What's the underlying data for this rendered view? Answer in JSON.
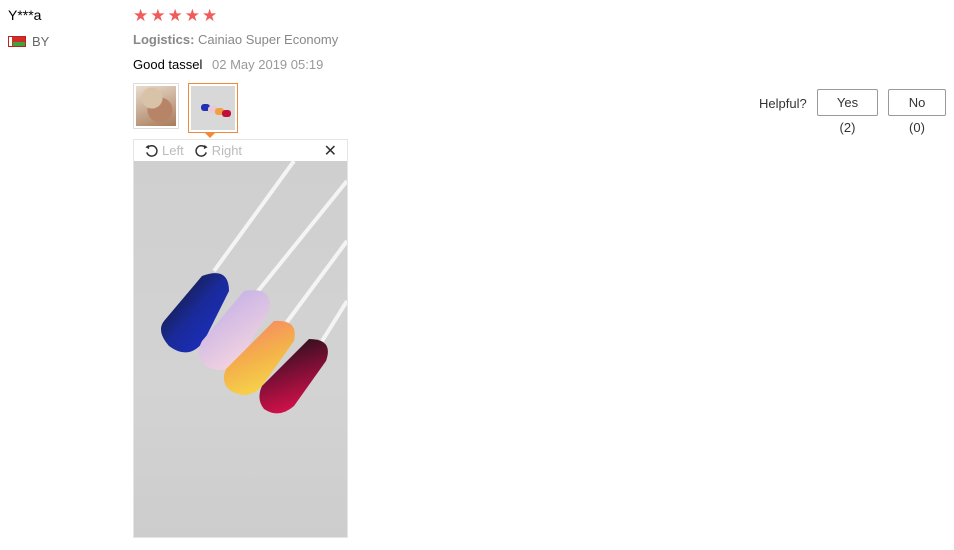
{
  "user": {
    "name": "Y***a",
    "country": "BY"
  },
  "rating": {
    "stars": 5
  },
  "logistics": {
    "label": "Logistics:",
    "value": "Cainiao Super Economy"
  },
  "review": {
    "text": "Good tassel",
    "date": "02 May 2019 05:19"
  },
  "thumbnails": [
    "nail-photo-hand",
    "nail-photo-swatches"
  ],
  "helpful": {
    "label": "Helpful?",
    "yes": "Yes (2)",
    "no": "No (0)"
  },
  "viewer": {
    "rotate_left": "Left",
    "rotate_right": "Right",
    "close_icon": "close-icon"
  },
  "colors": {
    "star": "#f05b5b",
    "accent": "#f08a3a"
  }
}
